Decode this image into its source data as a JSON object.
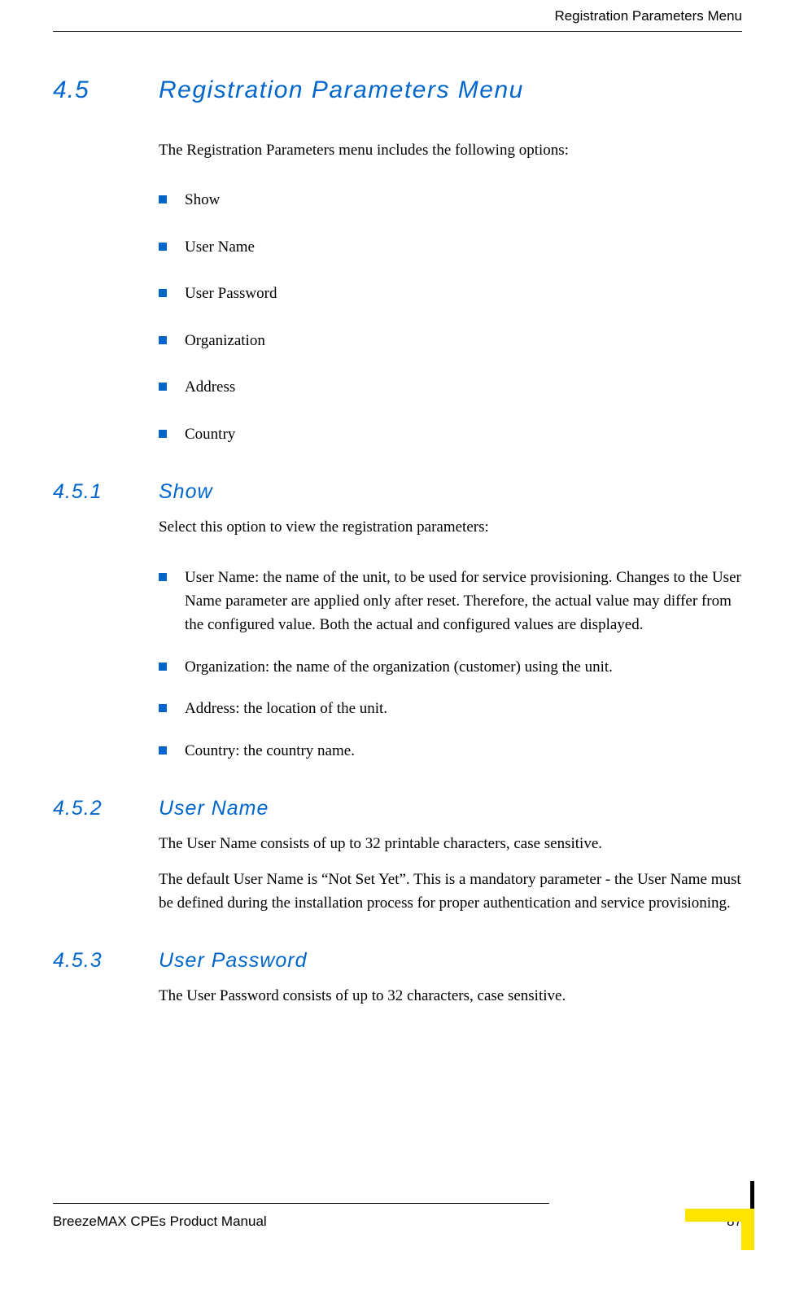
{
  "header": "Registration Parameters Menu",
  "s45": {
    "num": "4.5",
    "title": "Registration Parameters Menu",
    "intro": "The Registration Parameters menu includes the following options:",
    "items": [
      "Show",
      "User Name",
      "User Password",
      "Organization",
      "Address",
      "Country"
    ]
  },
  "s451": {
    "num": "4.5.1",
    "title": "Show",
    "intro": "Select this option to view the registration parameters:",
    "items": [
      "User Name: the name of the unit, to be used for service provisioning. Changes to the User Name parameter are applied only after reset. Therefore, the actual value may differ from the configured value. Both the actual and configured values are displayed.",
      "Organization: the name of the organization (customer) using the unit.",
      "Address: the location of the unit.",
      "Country: the country name."
    ]
  },
  "s452": {
    "num": "4.5.2",
    "title": "User Name",
    "p1": "The User Name consists of up to 32 printable characters, case sensitive.",
    "p2": "The default User Name is “Not Set Yet”. This is a mandatory parameter - the User Name must be defined during the installation process for proper authentication and service provisioning."
  },
  "s453": {
    "num": "4.5.3",
    "title": "User Password",
    "p1": "The User Password consists of up to 32 characters, case sensitive."
  },
  "footer": {
    "left": "BreezeMAX CPEs Product Manual",
    "page": "87"
  }
}
